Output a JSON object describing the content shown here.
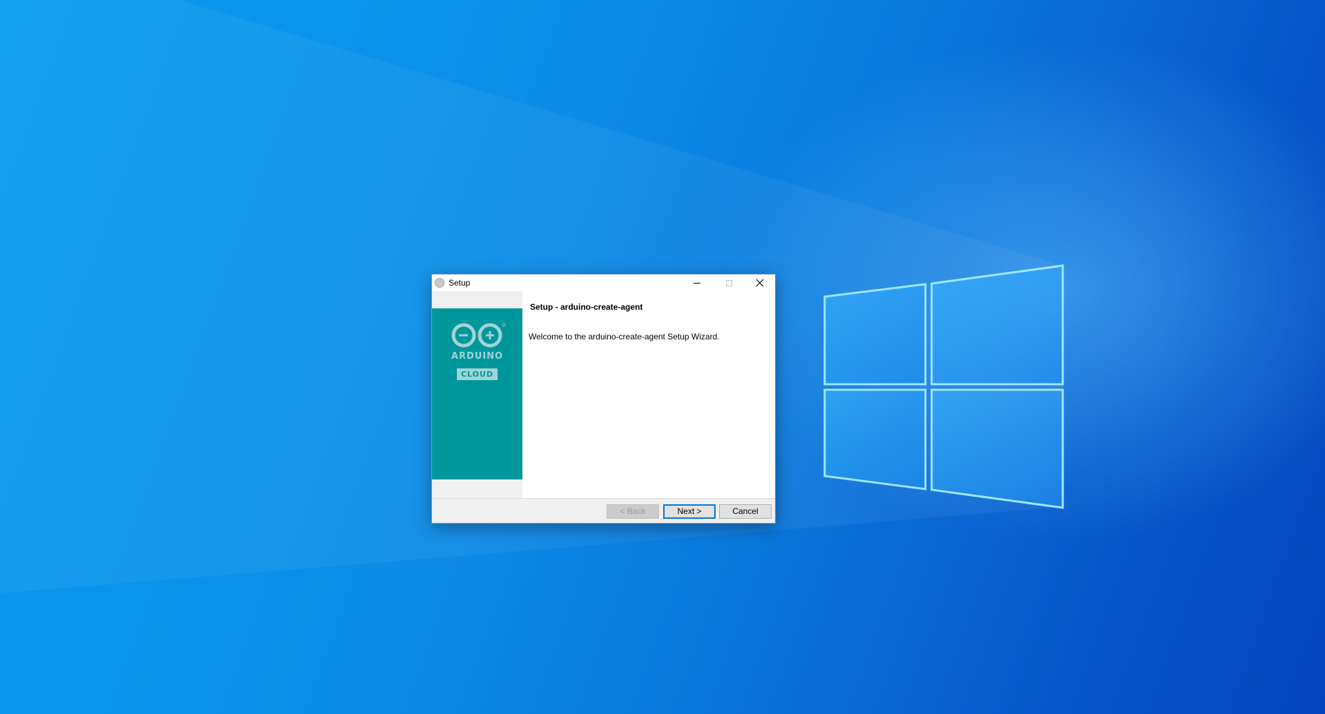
{
  "window": {
    "title": "Setup",
    "controls": {
      "minimize": "minimize",
      "maximize": "maximize",
      "close": "close"
    }
  },
  "sidebar": {
    "logo_word": "ARDUINO",
    "logo_badge": "CLOUD"
  },
  "content": {
    "heading": "Setup - arduino-create-agent",
    "welcome": "Welcome to the arduino-create-agent Setup Wizard."
  },
  "buttons": {
    "back": "< Back",
    "next": "Next >",
    "cancel": "Cancel"
  },
  "colors": {
    "logo_panel": "#00979c",
    "logo_light": "#9fd4d6",
    "focus_border": "#0078d7"
  }
}
